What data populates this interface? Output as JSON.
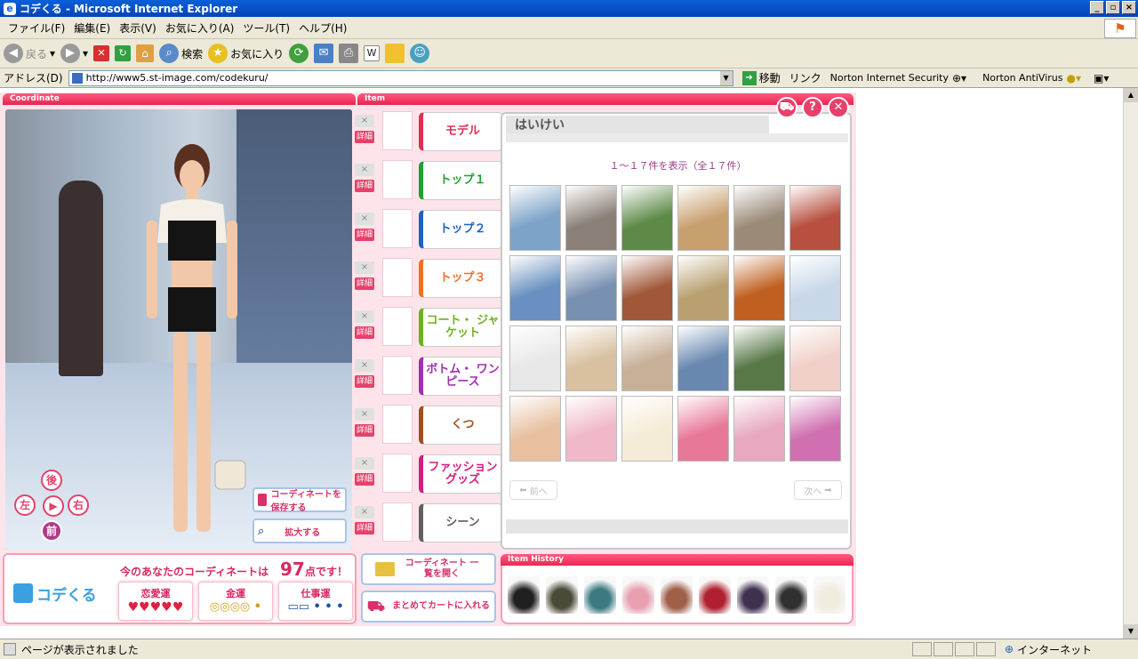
{
  "window": {
    "title": "コデくる - Microsoft Internet Explorer"
  },
  "menu": [
    "ファイル(F)",
    "編集(E)",
    "表示(V)",
    "お気に入り(A)",
    "ツール(T)",
    "ヘルプ(H)"
  ],
  "toolbar": {
    "back": "戻る",
    "search": "検索",
    "favorites": "お気に入り"
  },
  "address": {
    "label": "アドレス(D)",
    "url": "http://www5.st-image.com/codekuru/",
    "go": "移動",
    "links": "リンク",
    "norton_is": "Norton Internet Security",
    "norton_av": "Norton AntiVirus"
  },
  "app": {
    "coordinate_header": "Coordinate",
    "item_header": "Item",
    "history_header": "Item History",
    "directions": {
      "back": "後",
      "left": "左",
      "right": "右",
      "front": "前"
    },
    "save_button": "コーディネートを 保存する",
    "zoom_button": "拡大する",
    "categories": [
      {
        "label": "モデル",
        "color": "#e03050"
      },
      {
        "label": "トップ１",
        "color": "#20a030"
      },
      {
        "label": "トップ２",
        "color": "#2060c0"
      },
      {
        "label": "トップ３",
        "color": "#f07020"
      },
      {
        "label": "コート・ ジャケット",
        "color": "#70b020"
      },
      {
        "label": "ボトム・ ワンピース",
        "color": "#a030b0"
      },
      {
        "label": "くつ",
        "color": "#a05020"
      },
      {
        "label": "ファッション グッズ",
        "color": "#d02080"
      },
      {
        "label": "シーン",
        "color": "#606060"
      }
    ],
    "remove_label": "×",
    "detail_label": "詳細",
    "picker": {
      "title": "はいけい",
      "count": "１～１７件を表示（全１７件）",
      "prev": "前へ",
      "next": "次へ",
      "backgrounds": [
        "#7ea3c8",
        "#8a8078",
        "#5e8a48",
        "#c8a070",
        "#9a8a78",
        "#b85040",
        "#6890c0",
        "#7890b0",
        "#a05838",
        "#b8a070",
        "#c06020",
        "#c8d8e8",
        "#e8e8e8",
        "#d8c0a0",
        "#c8b098",
        "#6888b0",
        "#587848",
        "#f0d0c8",
        "#e8c0a0",
        "#f0b8c8",
        "#f5ecd8",
        "#e87898",
        "#e8a8c0",
        "#d070b0"
      ]
    },
    "score": {
      "prefix": "今のあなたのコーディネートは",
      "points": "97",
      "suffix": "点です！"
    },
    "logo": "コデくる",
    "fortunes": [
      {
        "label": "恋愛運",
        "icons": "♥♥♥♥♥"
      },
      {
        "label": "金運",
        "icons": "◎◎◎◎ •"
      },
      {
        "label": "仕事運",
        "icons": "▭▭ • • •"
      }
    ],
    "open_button": "コーディネート 一覧を開く",
    "cart_button": "まとめてカートに入れる",
    "history_items": [
      "#202020",
      "#4a4a38",
      "#3a7a80",
      "#e8a0b0",
      "#a06048",
      "#b02030",
      "#403050",
      "#303030",
      "#f0ece0"
    ]
  },
  "status": {
    "text": "ページが表示されました",
    "zone": "インターネット"
  }
}
